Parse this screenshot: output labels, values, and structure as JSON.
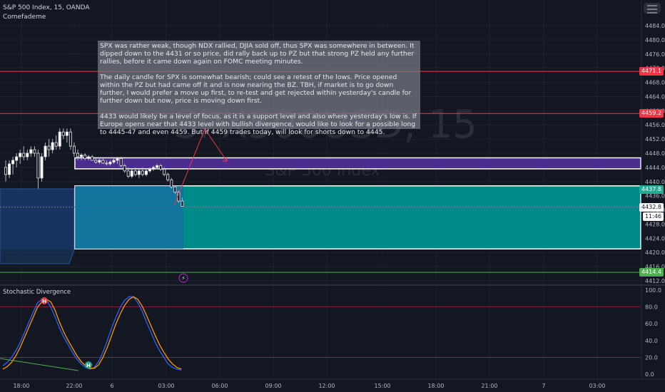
{
  "header": {
    "title": "S&P 500 Index, 15, OANDA",
    "indicator": "Comefademe"
  },
  "watermark": {
    "symbol": "SPX500USD, 15",
    "name": "S&P 500 Index"
  },
  "note": {
    "paragraphs": [
      "SPX was rather weak, though NDX rallied, DJIA sold off, thus SPX was somewhere in between. It dipped down to the 4431 or so price, did rally back up to PZ but that strong PZ held any further rallies, before it came down again on FOMC meeting minutes.",
      "The daily candle for SPX is somewhat bearish; could see a retest of the lows. Price opened within the PZ but had came off it and is now nearing the BZ. TBH, if market is to go down further, I would prefer a move up first, to re-test and get rejected within yesterday's candle for further down but now, price is moving down first.",
      "4433 would likely be a level of focus, as it is a support level and also where yesterday's low is. If Europe opens near that 4433 level with bullish divergence, would like to look for a possible long to 4445-47 and even 4459. But if 4459 trades today, will look for shorts down to 4445."
    ]
  },
  "price_axis": {
    "ticks": [
      "4484.0",
      "4480.0",
      "4476.0",
      "4472.0",
      "4468.0",
      "4464.0",
      "4460.0",
      "4456.0",
      "4452.0",
      "4448.0",
      "4444.0",
      "4440.0",
      "4436.0",
      "4432.0",
      "4428.0",
      "4424.0",
      "4420.0",
      "4416.0",
      "4412.0"
    ]
  },
  "price_labels": [
    {
      "text": "4471.1",
      "price": 4471.1,
      "color": "#f23645"
    },
    {
      "text": "4459.2",
      "price": 4459.2,
      "color": "#f23645"
    },
    {
      "text": "4437.8",
      "price": 4437.8,
      "color": "#22ab94"
    },
    {
      "text": "4432.8",
      "price": 4432.8,
      "color": "#ffffff"
    },
    {
      "text": "11:46",
      "price": 4431.0,
      "color": "#ffffff"
    },
    {
      "text": "4414.4",
      "price": 4414.4,
      "color": "#4caf50"
    }
  ],
  "time_axis": {
    "ticks": [
      "18:00",
      "22:00",
      "6",
      "03:00",
      "06:00",
      "09:00",
      "12:00",
      "15:00",
      "18:00",
      "21:00",
      "7",
      "03:00"
    ]
  },
  "stochastic": {
    "title": "Stochastic Divergence",
    "ticks": [
      "100.0",
      "80.0",
      "60.0",
      "40.0",
      "20.0",
      "0.0"
    ],
    "labels": [
      "H",
      "H"
    ]
  },
  "chart_data": [
    {
      "type": "line",
      "title": "S&P 500 Index, 15, OANDA",
      "ylim": [
        4411,
        4486
      ],
      "ohlc": [
        [
          4444,
          4446,
          4440,
          4442
        ],
        [
          4442,
          4446,
          4441,
          4445
        ],
        [
          4445,
          4447,
          4442,
          4446
        ],
        [
          4446,
          4448,
          4444,
          4447
        ],
        [
          4447,
          4449,
          4445,
          4448
        ],
        [
          4448,
          4450,
          4446,
          4447
        ],
        [
          4447,
          4449,
          4446,
          4448
        ],
        [
          4448,
          4450,
          4447,
          4449
        ],
        [
          4449,
          4450,
          4447,
          4448
        ],
        [
          4448,
          4449,
          4438,
          4441
        ],
        [
          4441,
          4448,
          4440,
          4447
        ],
        [
          4447,
          4451,
          4446,
          4450
        ],
        [
          4450,
          4452,
          4447,
          4449
        ],
        [
          4449,
          4452,
          4448,
          4451
        ],
        [
          4451,
          4453,
          4449,
          4450
        ],
        [
          4450,
          4455,
          4449,
          4454
        ],
        [
          4454,
          4455,
          4452,
          4453
        ],
        [
          4453,
          4455,
          4451,
          4454
        ],
        [
          4454,
          4455,
          4449,
          4450
        ],
        [
          4450,
          4451,
          4447,
          4448
        ],
        [
          4448,
          4449,
          4446,
          4447
        ],
        [
          4447,
          4448,
          4446,
          4447.5
        ],
        [
          4447.5,
          4448,
          4446,
          4446.5
        ],
        [
          4446.5,
          4447.5,
          4446,
          4447
        ],
        [
          4447,
          4447.5,
          4446,
          4446
        ],
        [
          4446,
          4446.5,
          4445,
          4445.5
        ],
        [
          4445.5,
          4446.5,
          4445,
          4446
        ],
        [
          4446,
          4446.5,
          4445,
          4445.2
        ],
        [
          4445.2,
          4446,
          4444.5,
          4445
        ],
        [
          4445,
          4446,
          4444.5,
          4445.5
        ],
        [
          4445.5,
          4446.5,
          4445,
          4446
        ],
        [
          4446,
          4447,
          4445,
          4446.5
        ],
        [
          4446.5,
          4447,
          4444,
          4444.5
        ],
        [
          4444.5,
          4445,
          4442.5,
          4443
        ],
        [
          4443,
          4444,
          4441,
          4441.5
        ],
        [
          4441.5,
          4443.5,
          4441,
          4443
        ],
        [
          4443,
          4444,
          4441.5,
          4442
        ],
        [
          4442,
          4443.5,
          4441,
          4443
        ],
        [
          4443,
          4444,
          4441.5,
          4442
        ],
        [
          4442,
          4443.5,
          4441.5,
          4443
        ],
        [
          4443,
          4444,
          4442.5,
          4443.5
        ],
        [
          4443.5,
          4444.5,
          4443,
          4444
        ],
        [
          4444,
          4445,
          4443.5,
          4444.5
        ],
        [
          4444.5,
          4445,
          4443,
          4443.5
        ],
        [
          4443.5,
          4444,
          4441.5,
          4442
        ],
        [
          4442,
          4442.5,
          4440,
          4440.5
        ],
        [
          4440.5,
          4441,
          4438,
          4438.5
        ],
        [
          4438.5,
          4439,
          4436.5,
          4437
        ],
        [
          4437,
          4437.5,
          4434,
          4434.5
        ],
        [
          4434.5,
          4435.5,
          4433.5,
          4433
        ]
      ],
      "levels": [
        {
          "name": "pz-zone",
          "from": 4443.6,
          "to": 4446.7,
          "color": "#4a2d8f"
        },
        {
          "name": "bz-zone",
          "from": 4421.0,
          "to": 4438.8,
          "color": "#008b8b"
        },
        {
          "name": "resistance-1",
          "price": 4471.1,
          "color": "#f23645"
        },
        {
          "name": "resistance-2",
          "price": 4459.2,
          "color": "#f23645"
        },
        {
          "name": "support",
          "price": 4414.4,
          "color": "#4caf50"
        },
        {
          "name": "last-price",
          "price": 4432.8,
          "color": "#787b86"
        }
      ]
    },
    {
      "type": "line",
      "title": "Stochastic Divergence",
      "ylim": [
        0,
        100
      ],
      "series": [
        {
          "values": [
            10,
            14,
            20,
            28,
            38,
            50,
            62,
            74,
            85,
            89,
            88,
            80,
            68,
            55,
            44,
            35,
            26,
            18,
            12,
            8,
            6,
            8,
            15,
            26,
            40,
            55,
            68,
            80,
            88,
            92,
            92,
            85,
            75,
            62,
            50,
            38,
            28,
            20,
            12,
            8,
            6,
            5
          ]
        },
        {
          "values": [
            6,
            9,
            14,
            22,
            32,
            44,
            56,
            68,
            80,
            86,
            89,
            86,
            76,
            62,
            50,
            40,
            31,
            22,
            15,
            10,
            7,
            7,
            11,
            20,
            32,
            46,
            60,
            72,
            82,
            89,
            92,
            89,
            81,
            70,
            58,
            46,
            35,
            26,
            18,
            12,
            8,
            6
          ]
        }
      ]
    }
  ]
}
